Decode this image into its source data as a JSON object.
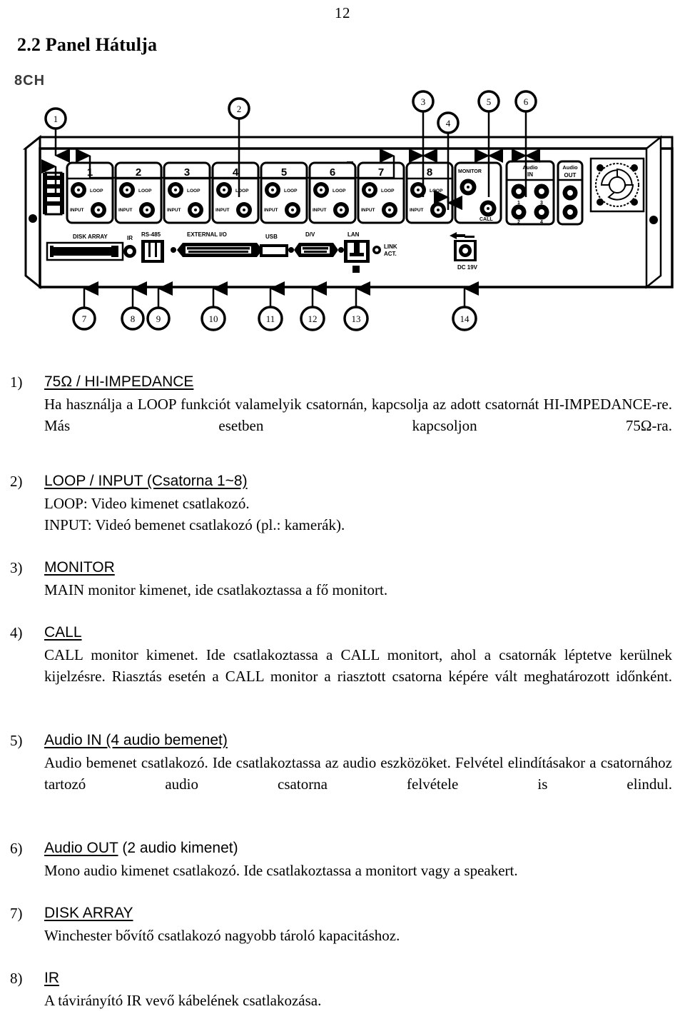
{
  "page": {
    "number": "12"
  },
  "section": {
    "heading": "2.2 Panel Hátulja"
  },
  "figure": {
    "channel_count_label": "8CH",
    "callouts_top": [
      "1",
      "2",
      "3",
      "4",
      "5",
      "6"
    ],
    "callouts_bottom": [
      "7",
      "8",
      "9",
      "10",
      "11",
      "12",
      "13",
      "14"
    ],
    "channels": [
      "1",
      "2",
      "3",
      "4",
      "5",
      "6",
      "7",
      "8"
    ],
    "channel_jack_labels": {
      "loop": "LOOP",
      "input": "INPUT"
    },
    "monitor_block": {
      "monitor_label": "MONITOR",
      "call_label": "CALL"
    },
    "audio_in": {
      "title_line1": "Audio",
      "title_line2": "IN",
      "jack_numbers": [
        "1",
        "3",
        "2",
        "4"
      ]
    },
    "audio_out": {
      "title_line1": "Audio",
      "title_line2": "OUT"
    },
    "rear_ports": [
      "DISK ARRAY",
      "IR",
      "RS-485",
      "EXTERNAL I/O",
      "USB",
      "D/V",
      "LAN",
      "DC 19V"
    ],
    "lan_led_label_line1": "LINK",
    "lan_led_label_line2": "ACT."
  },
  "items": [
    {
      "num": "1)",
      "title_underlined": "75Ω / HI-IMPEDANCE",
      "title_plain": "",
      "body": "Ha használja a LOOP funkciót valamelyik csatornán, kapcsolja az adott csatornát HI-IMPEDANCE-re. Más esetben kapcsoljon 75Ω-ra."
    },
    {
      "num": "2)",
      "title_underlined": "LOOP / INPUT (Csatorna 1~8)",
      "title_plain": "",
      "body_line1": "LOOP: Video kimenet csatlakozó.",
      "body_line2": "INPUT: Videó bemenet csatlakozó (pl.: kamerák)."
    },
    {
      "num": "3)",
      "title_underlined": "MONITOR",
      "title_plain": "",
      "body": "MAIN monitor kimenet, ide csatlakoztassa a fő monitort."
    },
    {
      "num": "4)",
      "title_underlined": "CALL",
      "title_plain": "",
      "body": "CALL monitor kimenet. Ide csatlakoztassa a CALL monitort, ahol a csatornák léptetve kerülnek kijelzésre. Riasztás esetén a CALL monitor a riasztott csatorna képére vált meghatározott időnként."
    },
    {
      "num": "5)",
      "title_underlined": "Audio IN (4 audio bemenet)",
      "title_plain": "",
      "body": "Audio bemenet csatlakozó. Ide csatlakoztassa az audio eszközöket. Felvétel elindításakor a csatornához tartozó audio csatorna felvétele is elindul."
    },
    {
      "num": "6)",
      "title_underlined": "Audio OUT",
      "title_plain": " (2 audio kimenet)",
      "body": "Mono audio kimenet csatlakozó. Ide csatlakoztassa a monitort vagy a speakert."
    },
    {
      "num": "7)",
      "title_underlined": "DISK ARRAY",
      "title_plain": "",
      "body": "Winchester bővítő csatlakozó nagyobb tároló kapacitáshoz."
    },
    {
      "num": "8)",
      "title_underlined": "IR",
      "title_plain": "",
      "body": "A távirányító IR vevő kábelének csatlakozása."
    }
  ]
}
